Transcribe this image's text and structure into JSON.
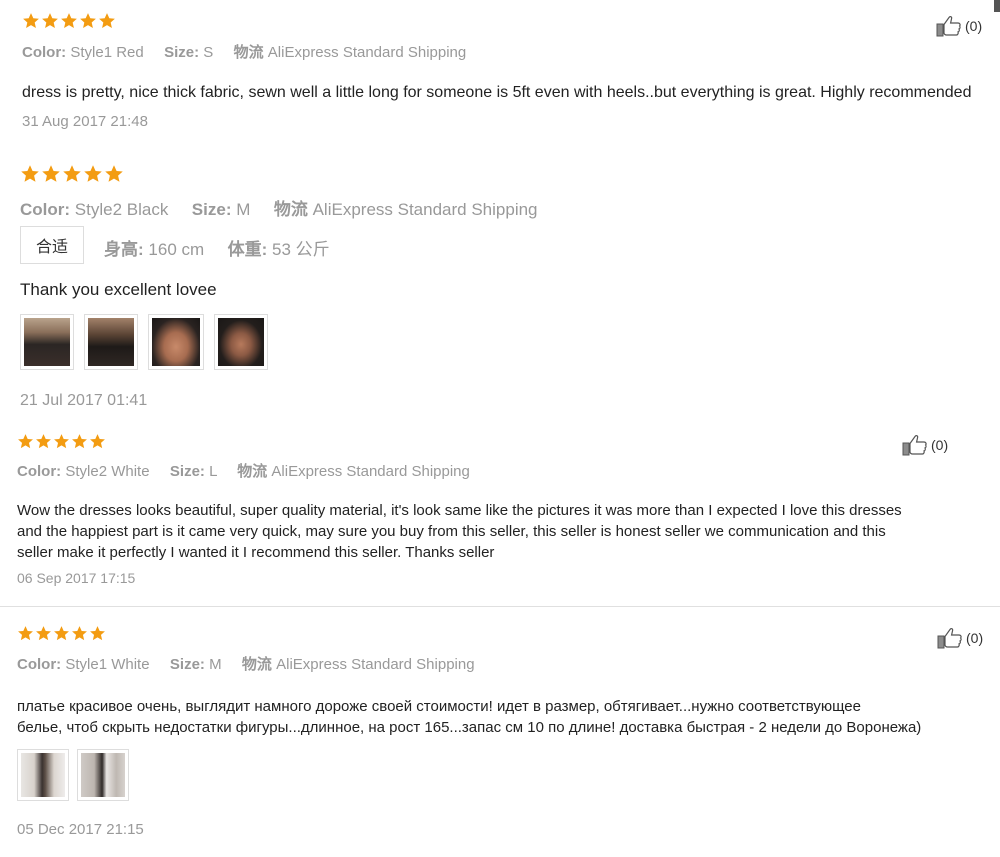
{
  "reviews": [
    {
      "rating": 5,
      "color_label": "Color:",
      "color_value": "Style1 Red",
      "size_label": "Size:",
      "size_value": "S",
      "logistics_label": "物流",
      "logistics_value": "AliExpress Standard Shipping",
      "content": "dress is pretty, nice thick fabric, sewn well a little long for someone is 5ft even with heels..but everything is great. Highly recommended",
      "date": "31 Aug 2017 21:48",
      "helpful_count": "(0)"
    },
    {
      "rating": 5,
      "color_label": "Color:",
      "color_value": "Style2 Black",
      "size_label": "Size:",
      "size_value": "M",
      "logistics_label": "物流",
      "logistics_value": "AliExpress Standard Shipping",
      "fit_label": "合适",
      "height_label": "身高:",
      "height_value": "160 cm",
      "weight_label": "体重:",
      "weight_value": "53 公斤",
      "content": "Thank you excellent lovee",
      "date": "21 Jul 2017 01:41"
    },
    {
      "rating": 5,
      "color_label": "Color:",
      "color_value": "Style2 White",
      "size_label": "Size:",
      "size_value": "L",
      "logistics_label": "物流",
      "logistics_value": "AliExpress Standard Shipping",
      "content_lines": [
        "Wow the dresses looks beautiful, super quality material, it's look same like the pictures it was more than I expected I love this dresses",
        "and the happiest part is it came very quick, may sure you buy from this seller, this seller is honest seller we communication and this",
        "seller make it perfectly I wanted it I recommend this seller. Thanks seller"
      ],
      "date": "06 Sep 2017 17:15",
      "helpful_count": "(0)"
    },
    {
      "rating": 5,
      "color_label": "Color:",
      "color_value": "Style1 White",
      "size_label": "Size:",
      "size_value": "M",
      "logistics_label": "物流",
      "logistics_value": "AliExpress Standard Shipping",
      "content_lines": [
        "платье красивое очень, выглядит намного дороже своей стоимости! идет в размер, обтягивает...нужно соответствующее",
        "белье, чтоб скрыть недостатки фигуры...длинное, на рост 165...запас см 10 по длине! доставка быстрая - 2 недели до Воронежа)"
      ],
      "date": "05 Dec 2017 21:15",
      "helpful_count": "(0)"
    }
  ],
  "colors": {
    "star": "#f39c12",
    "muted": "#999999",
    "text": "#222222"
  },
  "icons": {
    "star": "star-icon",
    "like": "thumbs-up-icon"
  }
}
